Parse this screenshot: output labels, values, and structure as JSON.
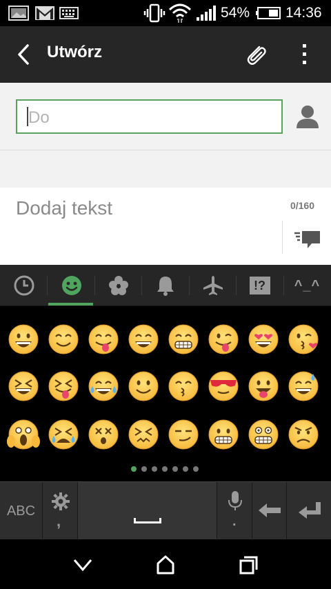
{
  "status": {
    "battery": "54%",
    "time": "14:36",
    "icons": [
      "gallery-notification-icon",
      "gmail-icon",
      "keyboard-icon",
      "vibrate-icon",
      "wifi-icon",
      "signal-icon",
      "battery-icon"
    ]
  },
  "actionbar": {
    "title": "Utwórz",
    "icons": [
      "back-arrow-icon",
      "paperclip-icon",
      "overflow-menu-icon"
    ]
  },
  "compose": {
    "to_placeholder": "Do",
    "message_placeholder": "Dodaj tekst",
    "char_count": "0/160"
  },
  "emoji_categories": {
    "tabs": [
      "recent-icon",
      "smiley-icon",
      "flower-icon",
      "bell-icon",
      "airplane-icon",
      "symbols-icon",
      "emoticon-text-icon"
    ],
    "emoticon_text": "^_^",
    "symbols_text": "!?",
    "selected": "smiley-icon",
    "accent_color": "#4fa45e"
  },
  "emoji_rows": [
    [
      "grinning",
      "smiling",
      "yum",
      "smile",
      "grimacing",
      "winking-tongue",
      "heart-eyes",
      "kissing-heart"
    ],
    [
      "laughing",
      "squinting-tongue",
      "joy",
      "relaxed",
      "kissing-closed-eyes",
      "sunglasses",
      "stuck-out-tongue",
      "sweat-smile"
    ],
    [
      "scream",
      "crying-loudly",
      "dizzy-face",
      "confounded",
      "smirk",
      "grimace-teeth",
      "fearful-grimace",
      "angry"
    ]
  ],
  "pages": {
    "count": 7,
    "active": 1
  },
  "keyboard": {
    "abc_label": "ABC",
    "settings_sub": ",",
    "mic_sub": "."
  },
  "navbar": {
    "icons": [
      "back-chevron-icon",
      "home-icon",
      "recents-icon"
    ]
  }
}
